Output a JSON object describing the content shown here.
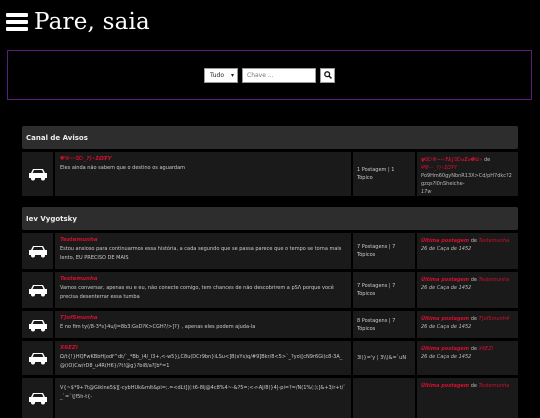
{
  "header": {
    "title": "Pare, saia"
  },
  "search": {
    "select_value": "Tudo",
    "placeholder": "Chave ..."
  },
  "sections": [
    {
      "name": "Canal de Avisos",
      "forums": [
        {
          "title": "Ψ®⋯⌦_?⟩∘ΣΩŦΥ",
          "desc": "Eles ainda não sabem que o destino os aguardam",
          "stats": "1 Postagem | 1 Tópico",
          "last_title": "ψ⌦®⋯∘‽λ∫⌦⌀Σ⌀Φ⊡∘",
          "last_by": "de",
          "last_user": "ΨΦ⋯_?⟩∘ΣΩŦΥ",
          "last_extra": "Po9Hm60gyNbnR13X>Cd/pH7dkc?2gzqs?l0nSheiche-",
          "last_date": "17w"
        }
      ]
    },
    {
      "name": "Iev Vygotsky",
      "forums": [
        {
          "title": "Testemunha",
          "desc": "Estou ansioso para continuarmos essa história, a cada segundo que se passa parece que o tempo se torna mais lento, EU PRECISO DE MAIS",
          "stats": "7 Postagens | 7 Tópicos",
          "last_label": "Última postagem",
          "last_by": "de",
          "last_user": "Testemunha",
          "last_date": "26 de Caça de 1452"
        },
        {
          "title": "Testemunha",
          "desc": "Vamos conversar, apenas eu e eu, não conecte comigo, tem chances de não descobrirem a pSΛ porque você precisa desenterrar essa tumba",
          "stats": "7 Postagens | 7 Tópicos",
          "last_label": "Última postagem",
          "last_by": "de",
          "last_user": "Testemunha",
          "last_date": "26 de Caça de 1452"
        },
        {
          "title": "T]ofSmunha",
          "desc": "E no fim ty(/8-3*s}4u/J=8b3:GsD?K>CGH?/>]?} , apenas eles podem ajuda-la",
          "stats": "8 Postagens | 7 Tópicos",
          "last_label": "Última postagem",
          "last_by": "de",
          "last_user": "T]ofSmunh4",
          "last_date": "26 de Caça de 1452"
        },
        {
          "title": "X6EZl",
          "desc": "Ω/t{!}HQFwKBbH|odf^dt/`_*Bb_)4/_l3+,<-w5}j,C8u(DCr9bn}iLSu<]B(xYs)q/#9]Bkr/8<5>`_?yo\\[cN9r6Gi(c8-3A_@(iO)Cw/rD8_u4R(H6}/?t!@g}?bi8/a?[b*=1",
          "stats": "3l)}='y | 3\\\\)&=`uN",
          "last_label": "Última postagem",
          "last_by": "de",
          "last_user": "X6EZl",
          "last_date": "26 de Caça de 1452"
        },
        {
          "title": "",
          "desc": "V{~$*9+7t@Giklne5$][-cybHUk&mIt&pi=;.=<dLt]|(:t6-8lj@4c8%4~-&?5=;<-r-AJ/8(}4|-pi=?=/N(1%(:);]&+3/r+t/`_`=`\\[f5h-t{-",
          "stats": "",
          "last_label": "Última postagem",
          "last_by": "de",
          "last_user": "Testemunha",
          "last_date": ""
        }
      ]
    }
  ]
}
